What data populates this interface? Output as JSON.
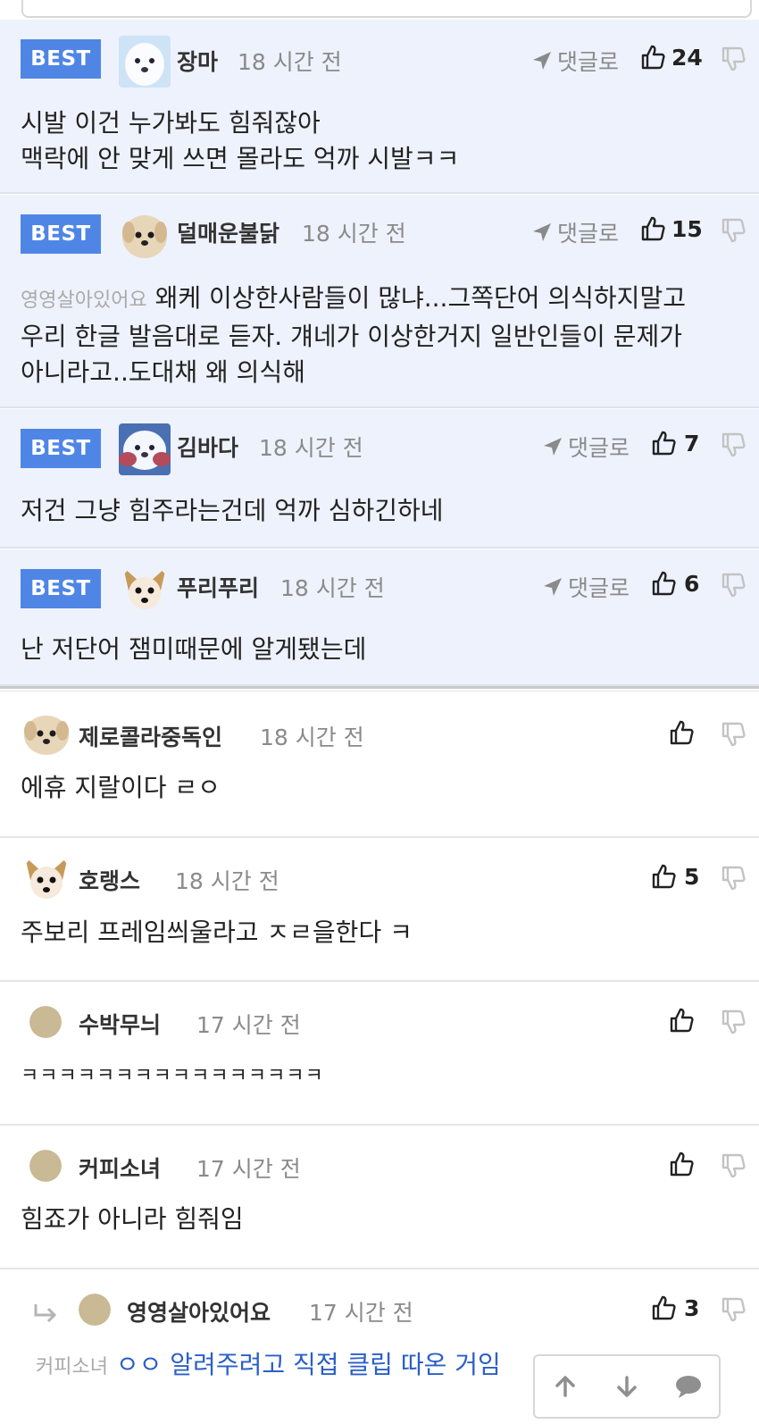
{
  "best_label": "BEST",
  "reply_label": "댓글로",
  "best_comments": [
    {
      "nick": "장마",
      "time": "18 시간 전",
      "likes": "24",
      "avatar": "white-dog-avatar",
      "lines": [
        "시발 이건 누가봐도 힘줘잖아",
        "맥락에 안 맞게 쓰면 몰라도 억까 시발ㅋㅋ"
      ]
    },
    {
      "nick": "덜매운불닭",
      "time": "18 시간 전",
      "likes": "15",
      "avatar": "puppy-face-avatar",
      "mention": "영영살아있어요",
      "lines": [
        "왜케 이상한사람들이 많냐...그쪽단어 의식하지말고",
        "우리 한글 발음대로 듣자. 걔네가 이상한거지 일반인들이 문제가",
        "아니라고..도대채 왜 의식해"
      ]
    },
    {
      "nick": "김바다",
      "time": "18 시간 전",
      "likes": "7",
      "avatar": "white-dog-blue-avatar",
      "lines": [
        "저건 그냥 힘주라는건데 억까 심하긴하네"
      ]
    },
    {
      "nick": "푸리푸리",
      "time": "18 시간 전",
      "likes": "6",
      "avatar": "chihuahua-avatar",
      "lines": [
        "난 저단어 잼미때문에 알게됐는데"
      ]
    }
  ],
  "comments": [
    {
      "nick": "제로콜라중독인",
      "time": "18 시간 전",
      "likes": "",
      "avatar": "puppy-face-avatar",
      "lines": [
        "에휴 지랄이다 ㄹㅇ"
      ]
    },
    {
      "nick": "호랭스",
      "time": "18 시간 전",
      "likes": "5",
      "avatar": "chihuahua-avatar",
      "lines": [
        "주보리 프레임씌울라고 ㅈㄹ을한다 ㅋ"
      ]
    },
    {
      "nick": "수박무늬",
      "time": "17 시간 전",
      "likes": "",
      "avatar": "default-avatar",
      "lines": [
        "ㅋㅋㅋㅋㅋㅋㅋㅋㅋㅋㅋㅋㅋㅋㅋㅋ"
      ]
    },
    {
      "nick": "커피소녀",
      "time": "17 시간 전",
      "likes": "",
      "avatar": "default-avatar",
      "lines": [
        "힘죠가 아니라 힘줘임"
      ]
    }
  ],
  "reply": {
    "nick": "영영살아있어요",
    "time": "17 시간 전",
    "likes": "3",
    "avatar": "default-avatar",
    "mention": "커피소녀",
    "text": "ㅇㅇ 알려주려고 직접 클립 따온 거임"
  },
  "colors": {
    "best_badge": "#4f86e6",
    "best_bg": "#eef2fc",
    "link_blue": "#2b5fc7",
    "muted": "#8a8a8a"
  },
  "icons": {
    "reply": "paper-plane-icon",
    "like": "thumbs-up-icon",
    "dislike": "thumbs-down-icon",
    "scroll_up": "arrow-up-icon",
    "scroll_down": "arrow-down-icon",
    "comments": "speech-bubble-icon"
  }
}
